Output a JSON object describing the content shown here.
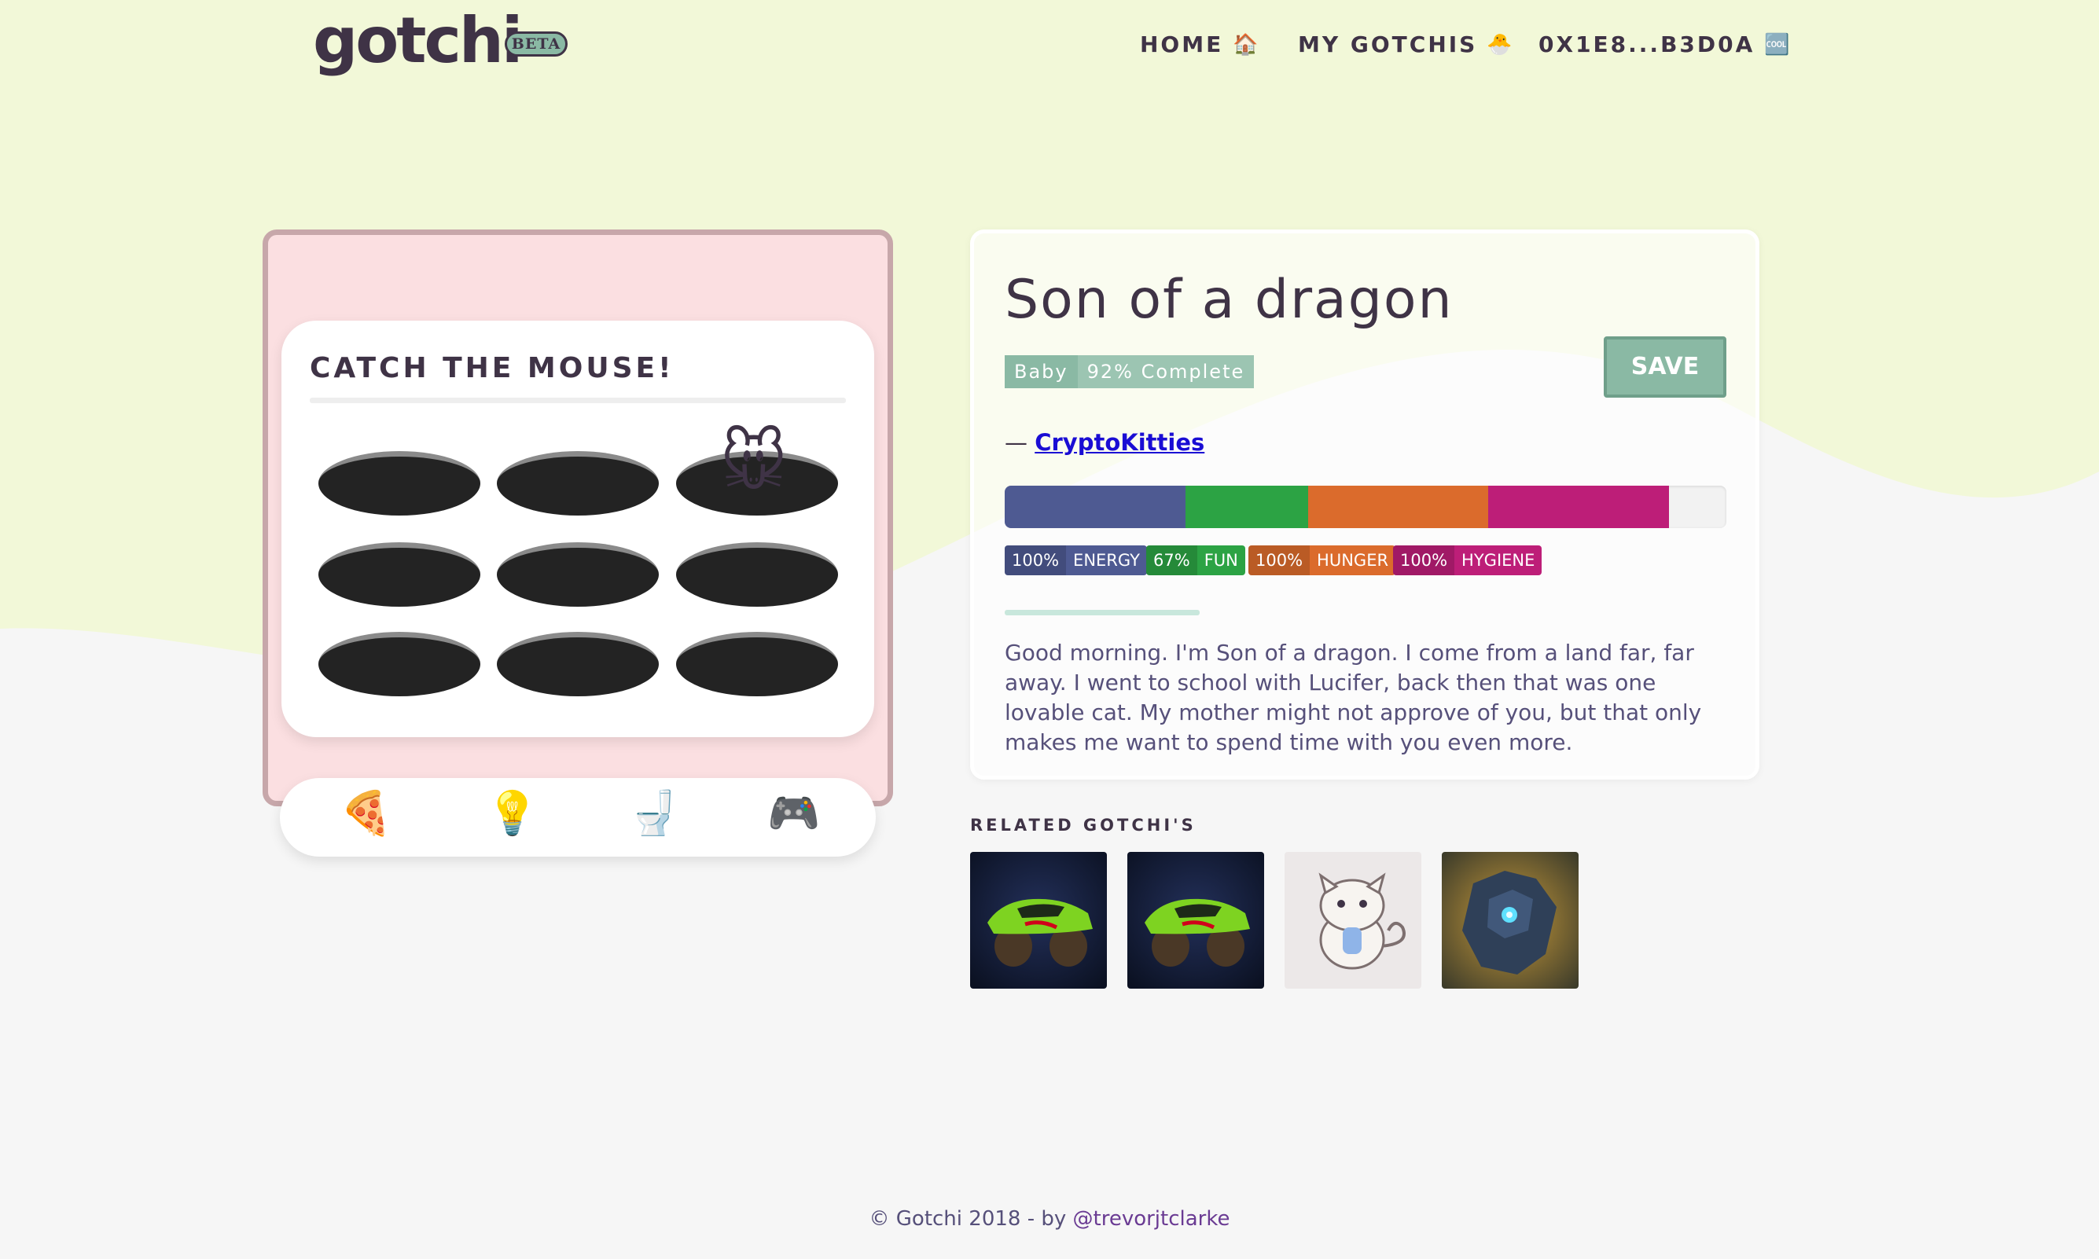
{
  "header": {
    "logo": "gotchi",
    "beta": "BETA",
    "nav": [
      {
        "label": "HOME",
        "icon": "🏠"
      },
      {
        "label": "MY GOTCHIS",
        "icon": "🐣"
      },
      {
        "label": "0X1E8...B3D0A",
        "icon": "🆒"
      }
    ]
  },
  "game": {
    "title": "CATCH THE MOUSE!",
    "mouse": "🐭",
    "actions": [
      "🍕",
      "💡",
      "🚽",
      "🎮"
    ]
  },
  "profile": {
    "name": "Son of a dragon",
    "stage": "Baby",
    "completion": "92% Complete",
    "save_label": "SAVE",
    "author_prefix": "— ",
    "author": "CryptoKitties",
    "stats": [
      {
        "pct": "100%",
        "label": "ENERGY",
        "color": "#4e5a92",
        "bar_share": 0.25
      },
      {
        "pct": "67%",
        "label": "FUN",
        "color": "#2ca344",
        "bar_share": 0.17
      },
      {
        "pct": "100%",
        "label": "HUNGER",
        "color": "#db6b2c",
        "bar_share": 0.25
      },
      {
        "pct": "100%",
        "label": "HYGIENE",
        "color": "#bd1e78",
        "bar_share": 0.25
      }
    ],
    "bio": "Good morning. I'm Son of a dragon. I come from a land far, far away. I went to school with Lucifer, back then that was one lovable cat. My mother might not approve of you, but that only makes me want to spend time with you even more."
  },
  "related": {
    "title": "RELATED GOTCHI'S",
    "items": [
      {
        "name": "monster-truck-gotchi"
      },
      {
        "name": "monster-truck-gotchi"
      },
      {
        "name": "cryptokitty-gotchi"
      },
      {
        "name": "golem-gotchi"
      }
    ]
  },
  "footer": {
    "text": "© Gotchi 2018 - by ",
    "handle": "@trevorjtclarke"
  },
  "colors": {
    "bg_green": "#f2f8d8",
    "bg_gray": "#f6f6f6",
    "accent": "#8ab9a4",
    "game_bg": "#fbdfe1"
  }
}
